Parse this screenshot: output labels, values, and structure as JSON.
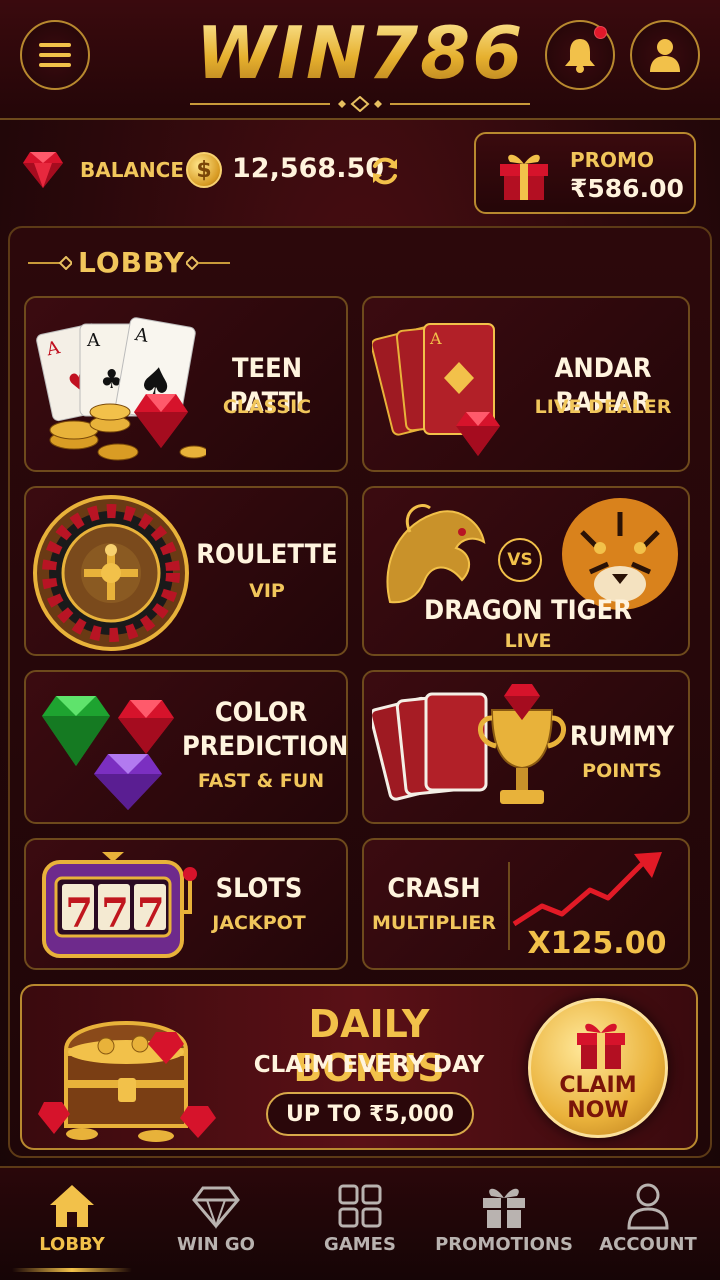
{
  "header": {
    "logo": "WIN786",
    "menu_icon": "hamburger-menu-icon",
    "bell_icon": "bell-icon",
    "user_icon": "user-icon"
  },
  "wallet": {
    "balance_label": "BALANCE",
    "currency_symbol": "$",
    "balance_value": "12,568.50",
    "promo_label": "PROMO",
    "promo_value": "₹586.00"
  },
  "lobby": {
    "title": "LOBBY",
    "games": [
      {
        "title": "TEEN PATTI",
        "subtitle": "CLASSIC"
      },
      {
        "title": "ANDAR BAHAR",
        "subtitle": "LIVE DEALER"
      },
      {
        "title": "ROULETTE",
        "subtitle": "VIP"
      },
      {
        "title": "DRAGON TIGER",
        "subtitle": "LIVE",
        "vs": "VS"
      },
      {
        "title": "COLOR PREDICTION",
        "subtitle": "FAST & FUN"
      },
      {
        "title": "RUMMY",
        "subtitle": "POINTS"
      },
      {
        "title": "SLOTS",
        "subtitle": "JACKPOT",
        "reel": "777"
      },
      {
        "title": "CRASH",
        "subtitle": "MULTIPLIER",
        "multiplier": "X125.00"
      }
    ]
  },
  "bonus": {
    "title": "DAILY BONUS",
    "subtitle": "CLAIM EVERY DAY",
    "amount": "UP TO ₹5,000",
    "claim_label": "CLAIM NOW"
  },
  "nav": {
    "items": [
      {
        "label": "LOBBY",
        "icon": "home-icon"
      },
      {
        "label": "WIN GO",
        "icon": "diamond-icon"
      },
      {
        "label": "GAMES",
        "icon": "grid-icon"
      },
      {
        "label": "PROMOTIONS",
        "icon": "gift-icon"
      },
      {
        "label": "ACCOUNT",
        "icon": "user-icon"
      }
    ]
  },
  "colors": {
    "gold": "#f2c14a",
    "maroon": "#2a080b",
    "accent_red": "#e2182a"
  }
}
